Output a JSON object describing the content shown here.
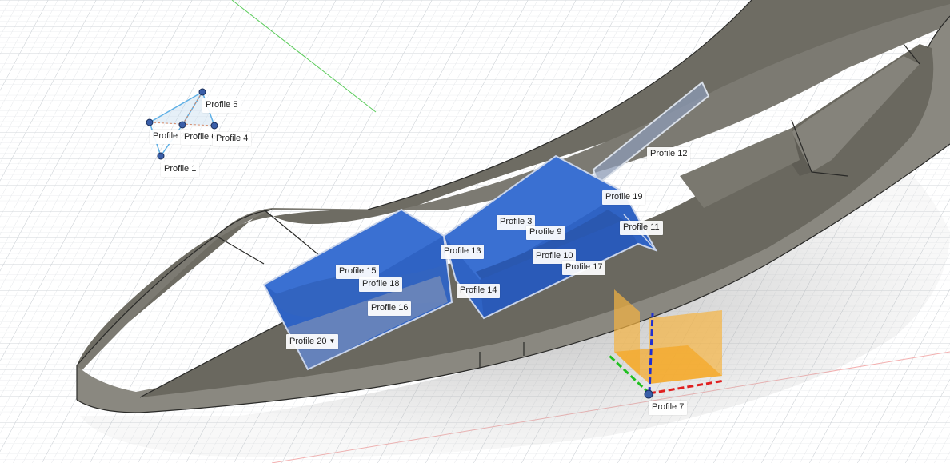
{
  "viewport": {
    "background": "#ffffff",
    "grid_color": "#d6d9dc",
    "body_color": "#76756e",
    "profile_fill": "#2f63c4",
    "axis_x_color": "#e02020",
    "axis_y_color": "#20c020",
    "axis_z_color": "#2030d0",
    "plane_color": "#f5b342"
  },
  "profiles": [
    {
      "id": "p1",
      "label": "Profile 1"
    },
    {
      "id": "p2",
      "label": "Profile 2"
    },
    {
      "id": "p3",
      "label": "Profile 3"
    },
    {
      "id": "p4",
      "label": "Profile 4"
    },
    {
      "id": "p5",
      "label": "Profile 5"
    },
    {
      "id": "p6",
      "label": "Profile 6"
    },
    {
      "id": "p7",
      "label": "Profile 7"
    },
    {
      "id": "p9",
      "label": "Profile 9"
    },
    {
      "id": "p10",
      "label": "Profile 10"
    },
    {
      "id": "p11",
      "label": "Profile 11"
    },
    {
      "id": "p12",
      "label": "Profile 12"
    },
    {
      "id": "p13",
      "label": "Profile 13"
    },
    {
      "id": "p14",
      "label": "Profile 14"
    },
    {
      "id": "p15",
      "label": "Profile 15"
    },
    {
      "id": "p16",
      "label": "Profile 16"
    },
    {
      "id": "p17",
      "label": "Profile 17"
    },
    {
      "id": "p18",
      "label": "Profile 18"
    },
    {
      "id": "p19",
      "label": "Profile 19"
    },
    {
      "id": "p20",
      "label": "Profile 20",
      "has_dropdown": true
    }
  ]
}
